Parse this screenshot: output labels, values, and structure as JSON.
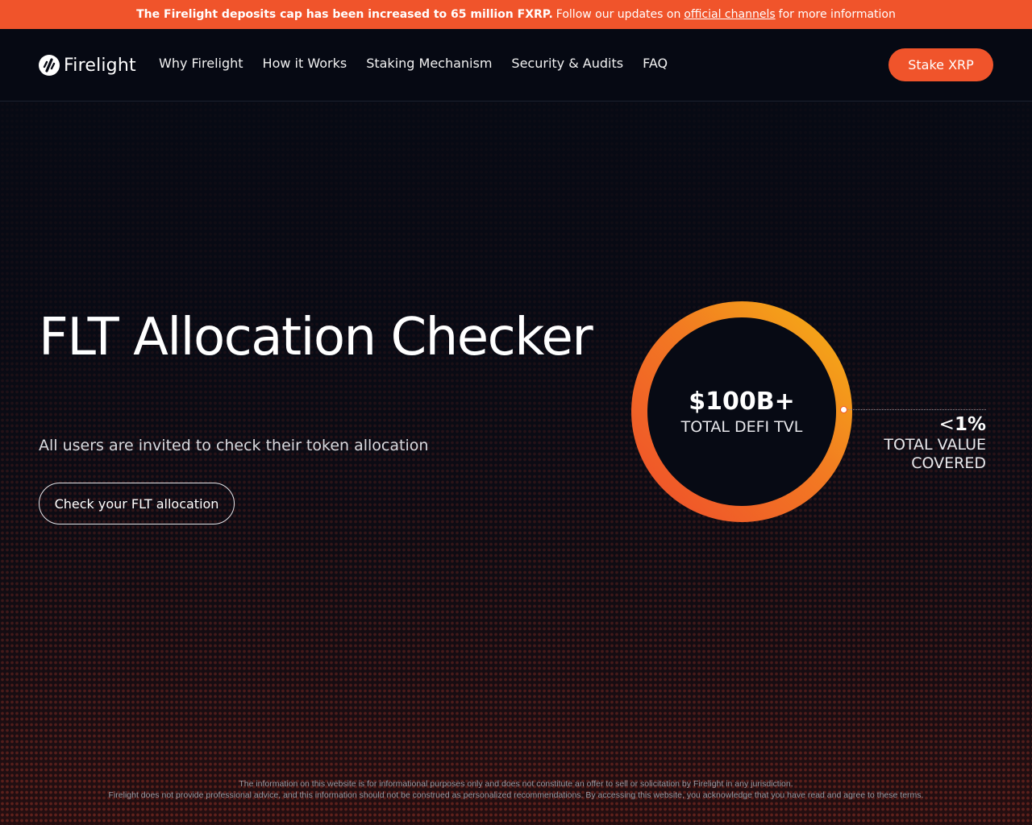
{
  "banner": {
    "bold_text": "The Firelight deposits cap has been increased to 65 million FXRP.",
    "text_before_link": "Follow our updates on",
    "link_text": "official channels",
    "text_after_link": "for more information",
    "background_color": "#f0542b"
  },
  "nav": {
    "logo_icon": "firelight-logo-icon",
    "logo_text": "Firelight",
    "links": [
      {
        "label": "Why Firelight"
      },
      {
        "label": "How it Works"
      },
      {
        "label": "Staking Mechanism"
      },
      {
        "label": "Security & Audits"
      },
      {
        "label": "FAQ"
      }
    ],
    "cta_label": "Stake XRP",
    "accent_color": "#f0542b"
  },
  "hero": {
    "title": "FLT Allocation Checker",
    "subtitle": "All users are invited to check their token allocation",
    "button_label": "Check your FLT allocation"
  },
  "stats": {
    "ring_value": "$100B+",
    "ring_label": "TOTAL DEFI TVL",
    "cover_prefix": "<",
    "cover_value": "1%",
    "cover_label_line1": "TOTAL VALUE",
    "cover_label_line2": "COVERED",
    "ring_gradient": [
      "#f5b015",
      "#f0542b"
    ]
  },
  "footer": {
    "disclaimer_line1": "The information on this website is for informational purposes only and does not constitute an offer to sell or solicitation by Firelight in any jurisdiction.",
    "disclaimer_line2": "Firelight does not provide professional advice, and this information should not be construed as personalized recommendations. By accessing this website, you acknowledge that you have read and agree to these terms."
  }
}
